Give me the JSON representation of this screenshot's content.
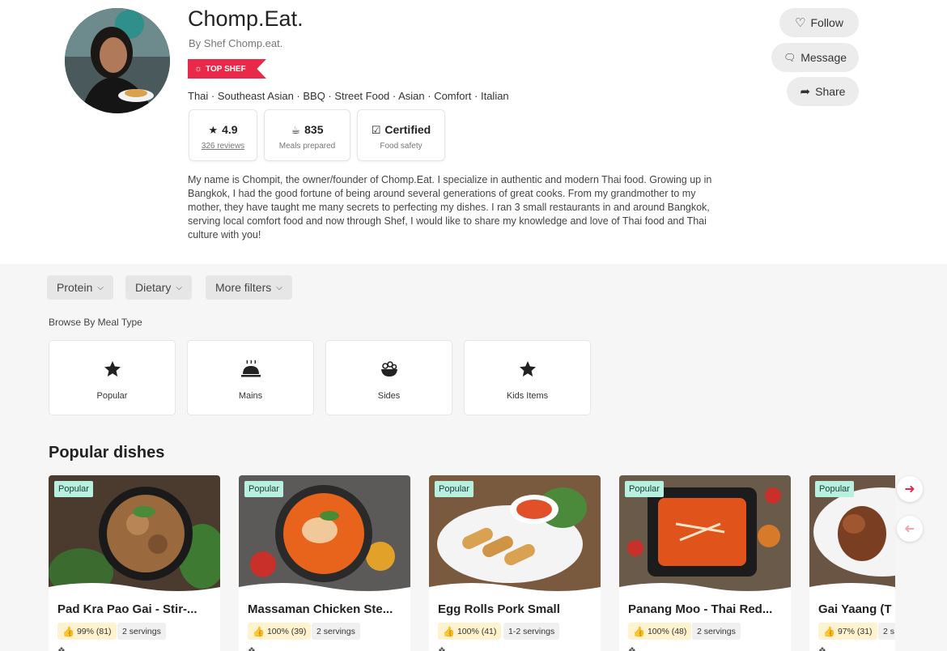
{
  "chef": {
    "name": "Chomp.Eat.",
    "by_line": "By Shef Chomp.eat.",
    "badge": "TOP SHEF",
    "cuisines": "Thai · Southeast Asian · BBQ · Street Food · Asian · Comfort · Italian",
    "about": "My name is Chompit, the owner/founder of Chomp.Eat. I specialize in authentic and modern Thai food. Growing up in Bangkok, I had the good fortune of being around several generations of great cooks. From my grandmother to my mother, they have taught me many secrets to perfecting my dishes. I ran 3 small restaurants in and around Bangkok, serving local comfort food and now through Shef, I would like to share my knowledge and love of Thai food and Thai culture with you!"
  },
  "stats": [
    {
      "icon": "star-icon",
      "value": "4.9",
      "sub": "326 reviews"
    },
    {
      "icon": "bowl-icon",
      "value": "835",
      "sub": "Meals prepared"
    },
    {
      "icon": "shield-check-icon",
      "value": "Certified",
      "sub": "Food safety"
    }
  ],
  "actions": {
    "follow": "Follow",
    "message": "Message",
    "share": "Share"
  },
  "filters": [
    "Protein",
    "Dietary",
    "More filters"
  ],
  "browse": {
    "label": "Browse By Meal Type",
    "types": [
      {
        "label": "Popular",
        "icon": "star-icon"
      },
      {
        "label": "Mains",
        "icon": "cloche-icon"
      },
      {
        "label": "Sides",
        "icon": "side-bowl-icon"
      },
      {
        "label": "Kids Items",
        "icon": "star-icon"
      }
    ]
  },
  "popular": {
    "title": "Popular dishes",
    "dishes": [
      {
        "tag": "Popular",
        "name": "Pad Kra Pao Gai - Stir-...",
        "rating": "99% (81)",
        "servings": "2 servings"
      },
      {
        "tag": "Popular",
        "name": "Massaman Chicken Ste...",
        "rating": "100% (39)",
        "servings": "2 servings"
      },
      {
        "tag": "Popular",
        "name": "Egg Rolls Pork Small",
        "rating": "100% (41)",
        "servings": "1-2 servings"
      },
      {
        "tag": "Popular",
        "name": "Panang Moo - Thai Red...",
        "rating": "100% (48)",
        "servings": "2 servings"
      },
      {
        "tag": "Popular",
        "name": "Gai Yaang (T",
        "rating": "97% (31)",
        "servings": "2 s"
      }
    ]
  },
  "colors": {
    "accent": "#e8294a",
    "tag_bg": "#b8f0e0",
    "rating_bg": "#fff3cf"
  }
}
